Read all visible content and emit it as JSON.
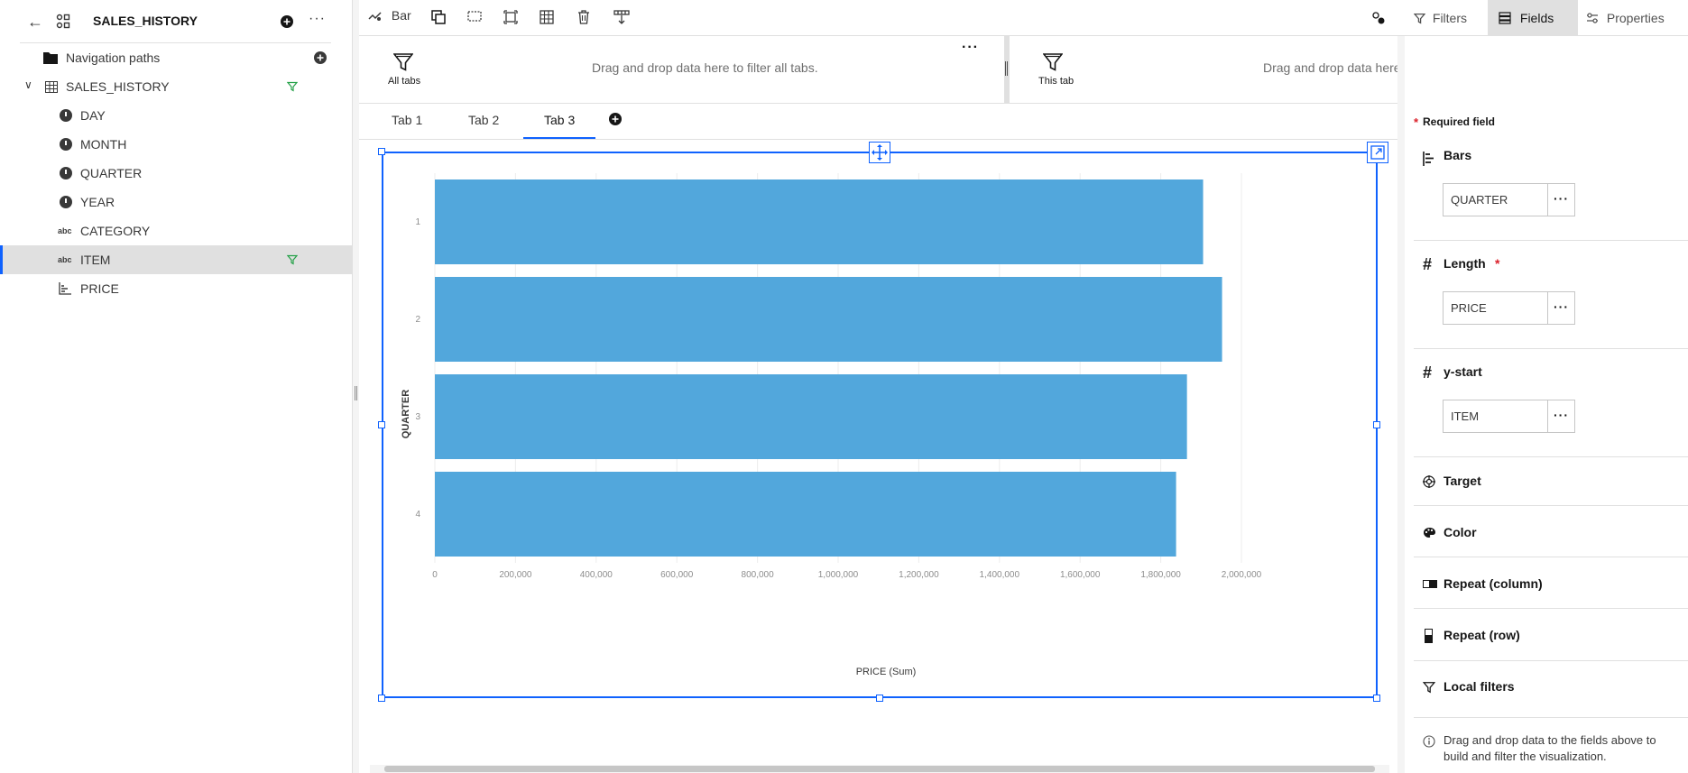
{
  "left_panel": {
    "title": "SALES_HISTORY",
    "tree": [
      {
        "label": "Navigation paths",
        "kind": "folder"
      },
      {
        "label": "SALES_HISTORY",
        "kind": "table",
        "filtered": true
      },
      {
        "label": "DAY",
        "kind": "time"
      },
      {
        "label": "MONTH",
        "kind": "time"
      },
      {
        "label": "QUARTER",
        "kind": "time"
      },
      {
        "label": "YEAR",
        "kind": "time"
      },
      {
        "label": "CATEGORY",
        "kind": "text"
      },
      {
        "label": "ITEM",
        "kind": "text",
        "filtered": true,
        "selected": true
      },
      {
        "label": "PRICE",
        "kind": "measure"
      }
    ],
    "abc_glyph": "abc"
  },
  "toolbar": {
    "chart_type_label": "Bar",
    "filters_label": "Filters",
    "fields_label": "Fields",
    "properties_label": "Properties"
  },
  "filter_bar": {
    "all_tabs_label": "All tabs",
    "all_tabs_hint": "Drag and drop data here to filter all tabs.",
    "this_tab_label": "This tab",
    "this_tab_hint": "Drag and drop data here to filter this tab.",
    "more": "···"
  },
  "tabs": [
    {
      "label": "Tab 1",
      "active": false
    },
    {
      "label": "Tab 2",
      "active": false
    },
    {
      "label": "Tab 3",
      "active": true
    }
  ],
  "fields_panel": {
    "required_note": "Required field",
    "sections": [
      {
        "title": "Bars",
        "value": "QUARTER"
      },
      {
        "title": "Length",
        "value": "PRICE",
        "required": true
      },
      {
        "title": "y-start",
        "value": "ITEM"
      },
      {
        "title": "Target"
      },
      {
        "title": "Color"
      },
      {
        "title": "Repeat (column)"
      },
      {
        "title": "Repeat (row)"
      },
      {
        "title": "Local filters"
      }
    ],
    "info_text": "Drag and drop data to the fields above to build and filter the visualization."
  },
  "colors": {
    "accent": "#0f62fe",
    "bar": "#52a7dc",
    "filter_green": "#24a148",
    "required": "#da1e28"
  },
  "chart_data": {
    "type": "bar",
    "orientation": "horizontal",
    "categories": [
      "1",
      "2",
      "3",
      "4"
    ],
    "values": [
      1905000,
      1952000,
      1865000,
      1838000
    ],
    "xlabel": "PRICE (Sum)",
    "ylabel": "QUARTER",
    "xticks": [
      "0",
      "200,000",
      "400,000",
      "600,000",
      "800,000",
      "1,000,000",
      "1,200,000",
      "1,400,000",
      "1,600,000",
      "1,800,000",
      "2,000,000"
    ],
    "xlim": [
      0,
      2000000
    ],
    "grid": true
  }
}
